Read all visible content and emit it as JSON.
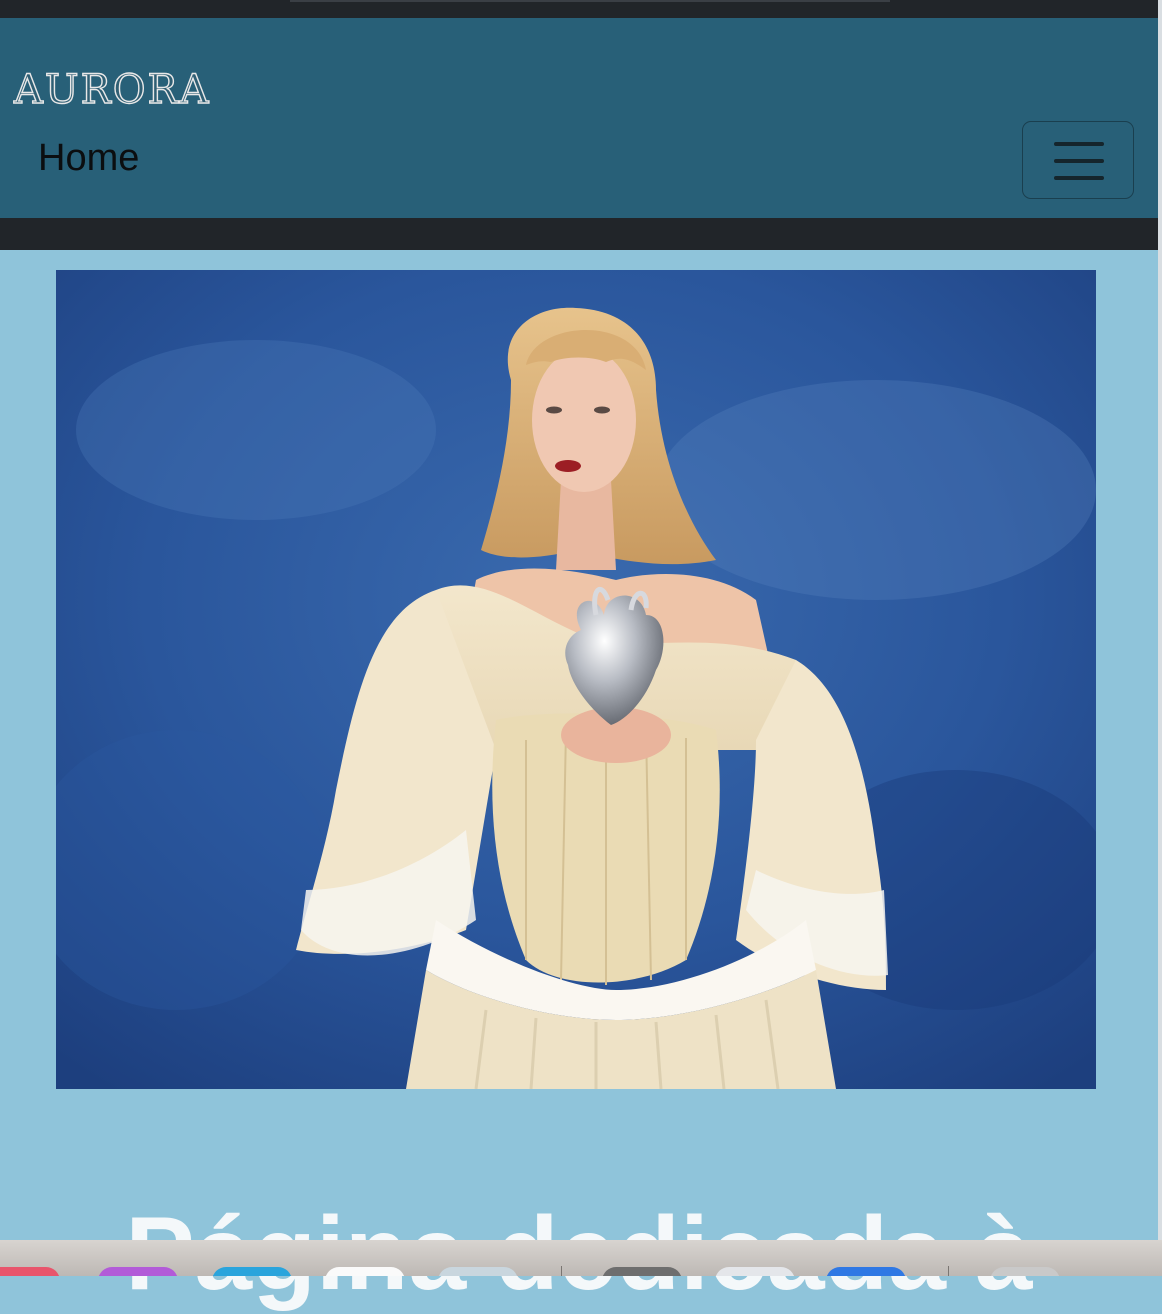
{
  "navbar": {
    "brand": "AURORA",
    "home_link": "Home",
    "toggler_icon": "hamburger-menu-icon"
  },
  "main": {
    "headline": "Página dedicada à"
  },
  "colors": {
    "navbar_bg": "#286078",
    "page_bg": "#8fc4da",
    "dark_band": "#212529",
    "headline_text": "#f4f8fa"
  },
  "dock": {
    "apps": [
      "red-app-icon",
      "purple-app-icon",
      "blue-app-icon",
      "white-app-icon",
      "light-app-icon",
      "gray-app-icon",
      "window-app-icon",
      "blue-app-icon-2",
      "silver-app-icon"
    ]
  }
}
